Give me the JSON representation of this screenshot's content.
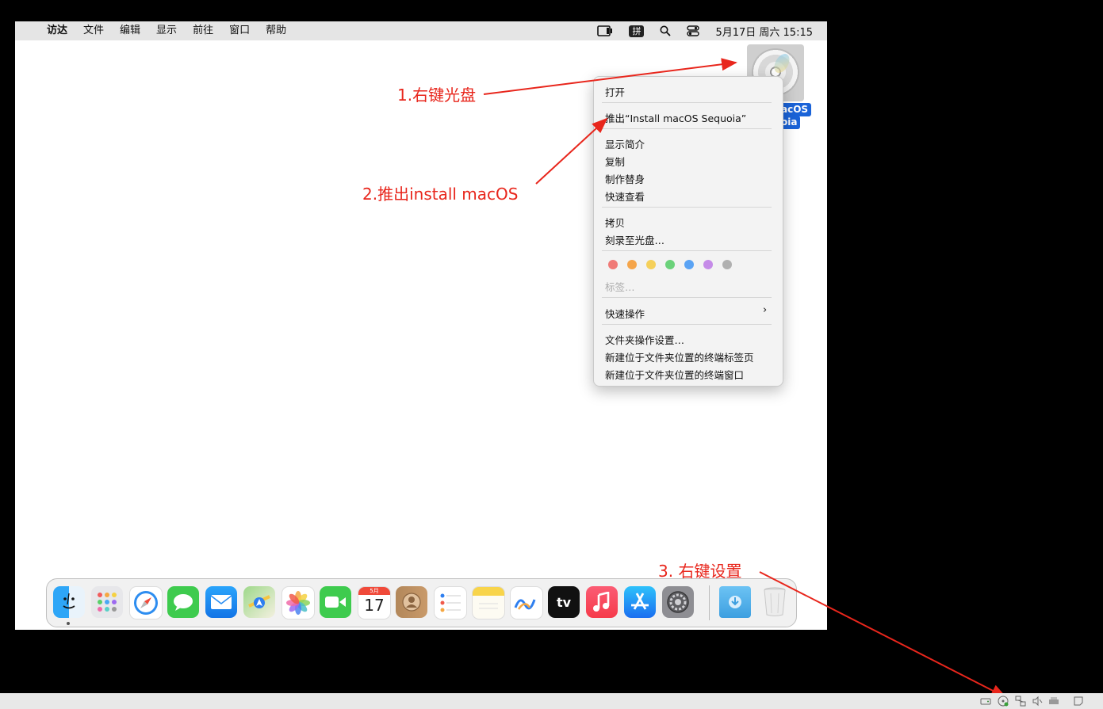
{
  "menubar": {
    "apple_glyph": "",
    "items": [
      "访达",
      "文件",
      "编辑",
      "显示",
      "前往",
      "窗口",
      "帮助"
    ],
    "ime": "拼",
    "clock": "5月17日 周六  15:15"
  },
  "desktop": {
    "disk_label_line1": "acOS",
    "disk_label_line2": "oia"
  },
  "context_menu": {
    "open": "打开",
    "eject": "推出“Install macOS Sequoia”",
    "get_info": "显示简介",
    "duplicate": "复制",
    "make_alias": "制作替身",
    "quick_look": "快速查看",
    "copy": "拷贝",
    "burn": "刻录至光盘…",
    "tag_colors": [
      "#f07a77",
      "#f5a54a",
      "#f5d05a",
      "#6bd27a",
      "#5aa3f4",
      "#c58be8",
      "#b0b0b0"
    ],
    "tags": "标签…",
    "quick_actions": "快速操作",
    "quick_actions_chevron": "›",
    "folder_actions": "文件夹操作设置…",
    "new_terminal_tab": "新建位于文件夹位置的终端标签页",
    "new_terminal_window": "新建位于文件夹位置的终端窗口"
  },
  "annotations": {
    "step1": "1.右键光盘",
    "step2": "2.推出install macOS",
    "step3": "3. 右键设置"
  },
  "dock": {
    "calendar_month": "5月",
    "calendar_day": "17",
    "appletv_label": "tv"
  }
}
